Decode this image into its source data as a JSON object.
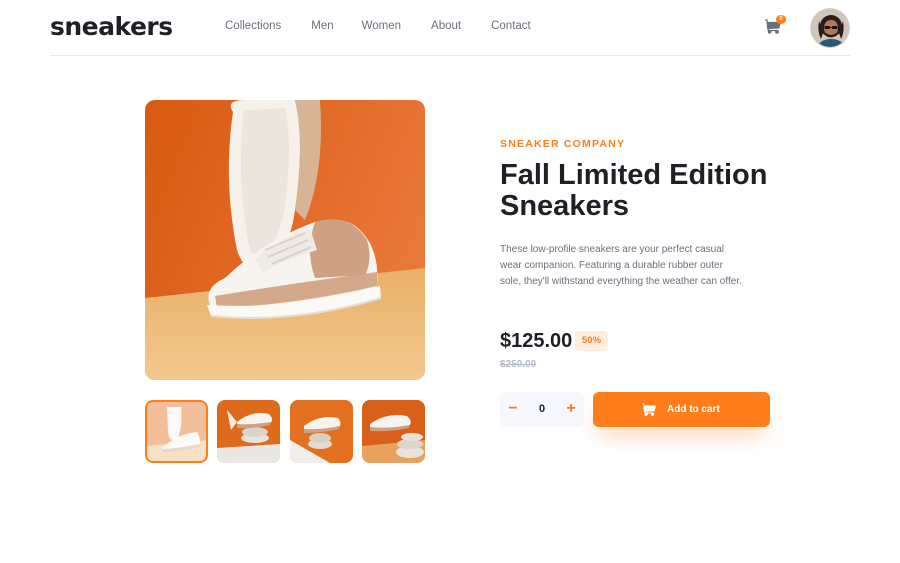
{
  "header": {
    "logo": "sneakers",
    "nav": [
      "Collections",
      "Men",
      "Women",
      "About",
      "Contact"
    ],
    "cart_count": "0",
    "cart_icon": "cart-icon",
    "avatar": "user-avatar"
  },
  "product": {
    "company": "SNEAKER COMPANY",
    "title": "Fall Limited Edition Sneakers",
    "description": "These low-profile sneakers are your perfect casual wear companion. Featuring a durable rubber outer sole, they'll withstand everything the weather can offer.",
    "price": "$125.00",
    "discount": "50%",
    "old_price": "$250.00"
  },
  "cart_form": {
    "minus": "−",
    "quantity": "0",
    "plus": "+",
    "add_label": "Add to cart"
  },
  "gallery": {
    "thumbnails": [
      "thumbnail-1",
      "thumbnail-2",
      "thumbnail-3",
      "thumbnail-4"
    ],
    "active_index": 0
  },
  "colors": {
    "accent": "#ff7d1a",
    "accent_light": "#ffede0",
    "dark": "#1d2026",
    "muted": "#69707d",
    "background": "#ffffff"
  }
}
